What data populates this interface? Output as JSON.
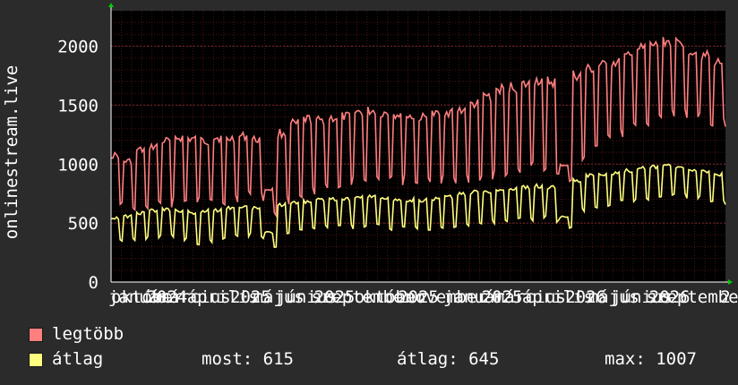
{
  "chart_data": {
    "type": "line",
    "ylabel": "onlinestream.live",
    "ylim": [
      0,
      2300
    ],
    "yticks": [
      0,
      500,
      1000,
      1500,
      2000
    ],
    "xlabels": [
      "október",
      "január",
      "2024",
      "március",
      "április",
      "2025",
      "május",
      "június",
      "2025",
      "szeptember",
      "október",
      "2025",
      "november",
      "január",
      "2025",
      "március",
      "április",
      "2026",
      "május",
      "június",
      "2026",
      "szeptember",
      "2"
    ],
    "colors": {
      "background": "#000000",
      "frame": "#2b2b2b",
      "grid": "#5a1a1a",
      "max": "#ff7f7f",
      "avg": "#ffff7f"
    },
    "series": [
      {
        "name": "legtöbb",
        "weekly": [
          [
            650,
            1100
          ],
          [
            600,
            1050
          ],
          [
            620,
            1150
          ],
          [
            640,
            1180
          ],
          [
            630,
            1230
          ],
          [
            650,
            1260
          ],
          [
            660,
            1250
          ],
          [
            620,
            1230
          ],
          [
            640,
            1260
          ],
          [
            650,
            1250
          ],
          [
            700,
            1270
          ],
          [
            680,
            1240
          ],
          [
            560,
            800
          ],
          [
            650,
            1300
          ],
          [
            700,
            1380
          ],
          [
            740,
            1420
          ],
          [
            760,
            1410
          ],
          [
            780,
            1430
          ],
          [
            800,
            1440
          ],
          [
            820,
            1480
          ],
          [
            830,
            1490
          ],
          [
            810,
            1470
          ],
          [
            820,
            1460
          ],
          [
            800,
            1440
          ],
          [
            790,
            1430
          ],
          [
            810,
            1460
          ],
          [
            820,
            1480
          ],
          [
            830,
            1500
          ],
          [
            850,
            1550
          ],
          [
            870,
            1620
          ],
          [
            880,
            1680
          ],
          [
            900,
            1700
          ],
          [
            920,
            1720
          ],
          [
            940,
            1760
          ],
          [
            880,
            1750
          ],
          [
            850,
            1000
          ],
          [
            1000,
            1800
          ],
          [
            1100,
            1850
          ],
          [
            1150,
            1880
          ],
          [
            1200,
            1900
          ],
          [
            1250,
            1950
          ],
          [
            1300,
            2020
          ],
          [
            1350,
            2050
          ],
          [
            1400,
            2080
          ],
          [
            1380,
            2070
          ],
          [
            1350,
            2000
          ],
          [
            1300,
            1960
          ],
          [
            1300,
            1900
          ]
        ]
      },
      {
        "name": "átlag",
        "weekly": [
          [
            330,
            560
          ],
          [
            340,
            570
          ],
          [
            350,
            600
          ],
          [
            360,
            620
          ],
          [
            370,
            630
          ],
          [
            350,
            620
          ],
          [
            300,
            610
          ],
          [
            330,
            620
          ],
          [
            340,
            630
          ],
          [
            360,
            650
          ],
          [
            380,
            660
          ],
          [
            350,
            650
          ],
          [
            280,
            430
          ],
          [
            400,
            670
          ],
          [
            420,
            690
          ],
          [
            430,
            700
          ],
          [
            440,
            710
          ],
          [
            440,
            715
          ],
          [
            450,
            720
          ],
          [
            460,
            740
          ],
          [
            460,
            745
          ],
          [
            440,
            730
          ],
          [
            440,
            720
          ],
          [
            430,
            715
          ],
          [
            420,
            710
          ],
          [
            440,
            720
          ],
          [
            450,
            740
          ],
          [
            460,
            760
          ],
          [
            470,
            780
          ],
          [
            480,
            790
          ],
          [
            490,
            800
          ],
          [
            500,
            810
          ],
          [
            510,
            820
          ],
          [
            520,
            830
          ],
          [
            500,
            820
          ],
          [
            450,
            560
          ],
          [
            580,
            880
          ],
          [
            620,
            920
          ],
          [
            640,
            930
          ],
          [
            650,
            940
          ],
          [
            660,
            960
          ],
          [
            680,
            980
          ],
          [
            700,
            990
          ],
          [
            720,
            1000
          ],
          [
            710,
            990
          ],
          [
            690,
            970
          ],
          [
            680,
            950
          ],
          [
            650,
            930
          ]
        ]
      }
    ]
  },
  "legend": [
    {
      "label": "legtöbb",
      "color": "#ff7f7f"
    },
    {
      "label": "átlag",
      "color": "#ffff7f"
    }
  ],
  "stats": {
    "now": "most: 615",
    "avg": "átlag: 645",
    "max": "max: 1007"
  }
}
